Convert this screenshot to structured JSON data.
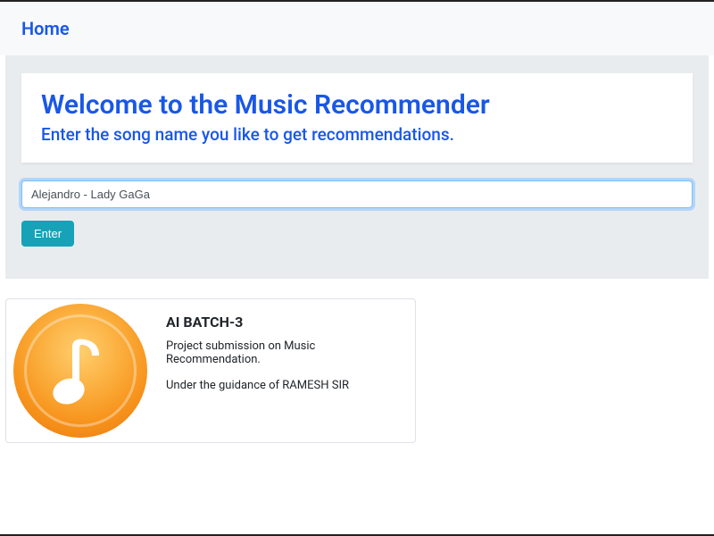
{
  "nav": {
    "home": "Home"
  },
  "header": {
    "title": "Welcome to the Music Recommender",
    "subtitle": "Enter the song name you like to get recommendations."
  },
  "form": {
    "input_value": "Alejandro - Lady GaGa",
    "enter_label": "Enter"
  },
  "card": {
    "title": "AI BATCH-3",
    "line1": "Project submission on Music Recommendation.",
    "line2": "Under the guidance of RAMESH SIR"
  }
}
